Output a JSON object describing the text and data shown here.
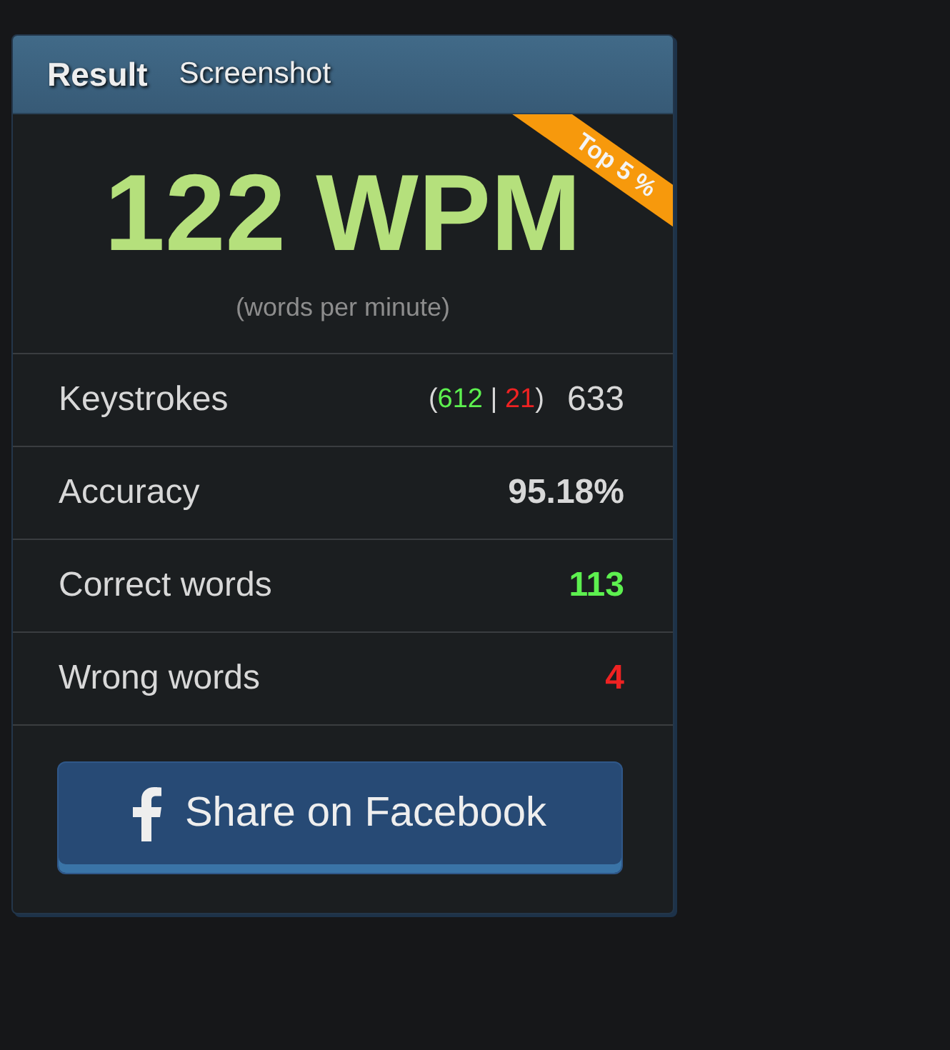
{
  "tabs": [
    {
      "label": "Result",
      "selected": true
    },
    {
      "label": "Screenshot",
      "selected": false
    }
  ],
  "ribbon": "Top 5 %",
  "speed": {
    "value": "122 WPM",
    "caption": "(words per minute)"
  },
  "stats": [
    {
      "kind": "breakdown",
      "label": "Keystrokes",
      "open": "(",
      "correct": "612",
      "separator": "|",
      "wrong": "21",
      "close": ")",
      "value": "633",
      "color": "#d8d8d8",
      "bold": false
    },
    {
      "kind": "single",
      "label": "Accuracy",
      "value": "95.18%",
      "color": "#d8d8d8",
      "bold": true
    },
    {
      "kind": "single",
      "label": "Correct words",
      "value": "113",
      "color": "#5df04f",
      "bold": true
    },
    {
      "kind": "single",
      "label": "Wrong words",
      "value": "4",
      "color": "#ee2222",
      "bold": true
    }
  ],
  "share_button": "Share on Facebook"
}
